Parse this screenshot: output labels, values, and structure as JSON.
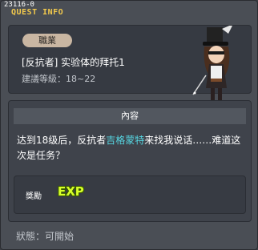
{
  "window": {
    "quest_id": "23116-0",
    "title": "QUEST INFO"
  },
  "quest": {
    "category_badge": "職業",
    "name": "[反抗者] 实验体的拜托1",
    "level_range": "建議等級：18~22"
  },
  "content": {
    "header": "內容",
    "text_before": "达到18级后，反抗者",
    "npc_name": "吉格蒙特",
    "text_after": "来找我说话……难道这次是任务？"
  },
  "reward": {
    "label": "獎勵",
    "item_label": "EXP"
  },
  "status": {
    "text": "狀態：可開始"
  },
  "colors": {
    "title": "#f2c94c",
    "npc": "#56d6e2",
    "exp": "#d8ff2a"
  }
}
